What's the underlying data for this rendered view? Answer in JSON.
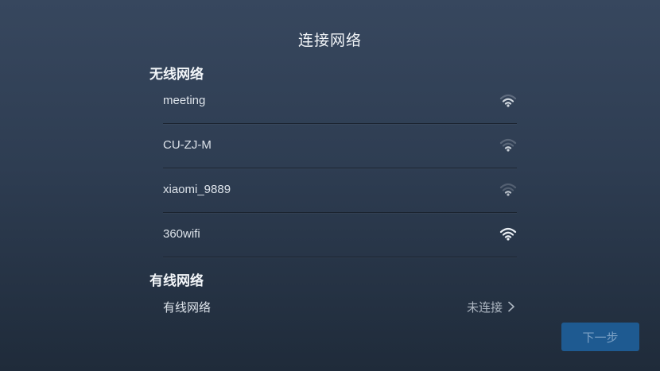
{
  "header": {
    "title": "连接网络"
  },
  "wireless": {
    "title": "无线网络",
    "networks": [
      {
        "name": "meeting",
        "signal_icon": "wifi-signal-icon",
        "signal_level": 0.7
      },
      {
        "name": "CU-ZJ-M",
        "signal_icon": "wifi-signal-icon",
        "signal_level": 0.6
      },
      {
        "name": "xiaomi_9889",
        "signal_icon": "wifi-signal-icon",
        "signal_level": 0.4
      },
      {
        "name": "360wifi",
        "signal_icon": "wifi-signal-icon",
        "signal_level": 1.0
      }
    ]
  },
  "wired": {
    "title": "有线网络",
    "item_label": "有线网络",
    "status": "未连接",
    "chevron_icon": "chevron-right-icon"
  },
  "footer": {
    "next_label": "下一步"
  },
  "colors": {
    "background_top": "#37475e",
    "background_bottom": "#1f2b3a",
    "button_bg": "#1e5a91",
    "button_text": "#7da2c6"
  }
}
